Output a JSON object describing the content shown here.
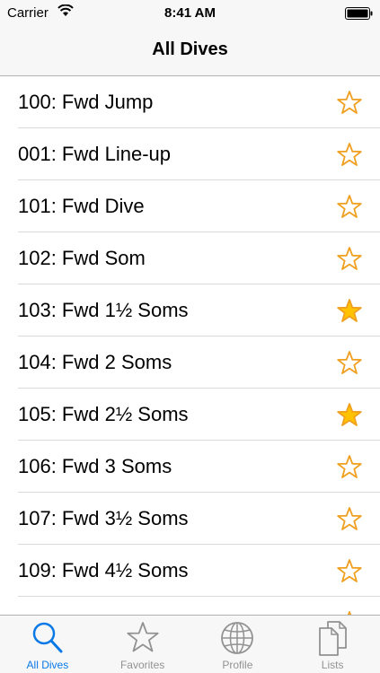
{
  "statusbar": {
    "carrier": "Carrier",
    "time": "8:41 AM"
  },
  "navbar": {
    "title": "All Dives"
  },
  "dives": [
    {
      "label": "100: Fwd Jump",
      "favorite": false
    },
    {
      "label": "001: Fwd Line-up",
      "favorite": false
    },
    {
      "label": "101: Fwd Dive",
      "favorite": false
    },
    {
      "label": "102: Fwd Som",
      "favorite": false
    },
    {
      "label": "103: Fwd 1½ Soms",
      "favorite": true
    },
    {
      "label": "104: Fwd 2 Soms",
      "favorite": false
    },
    {
      "label": "105: Fwd 2½ Soms",
      "favorite": true
    },
    {
      "label": "106: Fwd 3 Soms",
      "favorite": false
    },
    {
      "label": "107: Fwd 3½ Soms",
      "favorite": false
    },
    {
      "label": "109: Fwd 4½ Soms",
      "favorite": false
    },
    {
      "label": "",
      "favorite": false
    }
  ],
  "tabs": [
    {
      "label": "All Dives",
      "icon": "search-icon",
      "active": true
    },
    {
      "label": "Favorites",
      "icon": "star-icon",
      "active": false
    },
    {
      "label": "Profile",
      "icon": "globe-icon",
      "active": false
    },
    {
      "label": "Lists",
      "icon": "documents-icon",
      "active": false
    }
  ],
  "colors": {
    "accent": "#0a79e6",
    "star_outline": "#f0a020",
    "star_fill": "#ffc200",
    "inactive_tab": "#929292"
  }
}
